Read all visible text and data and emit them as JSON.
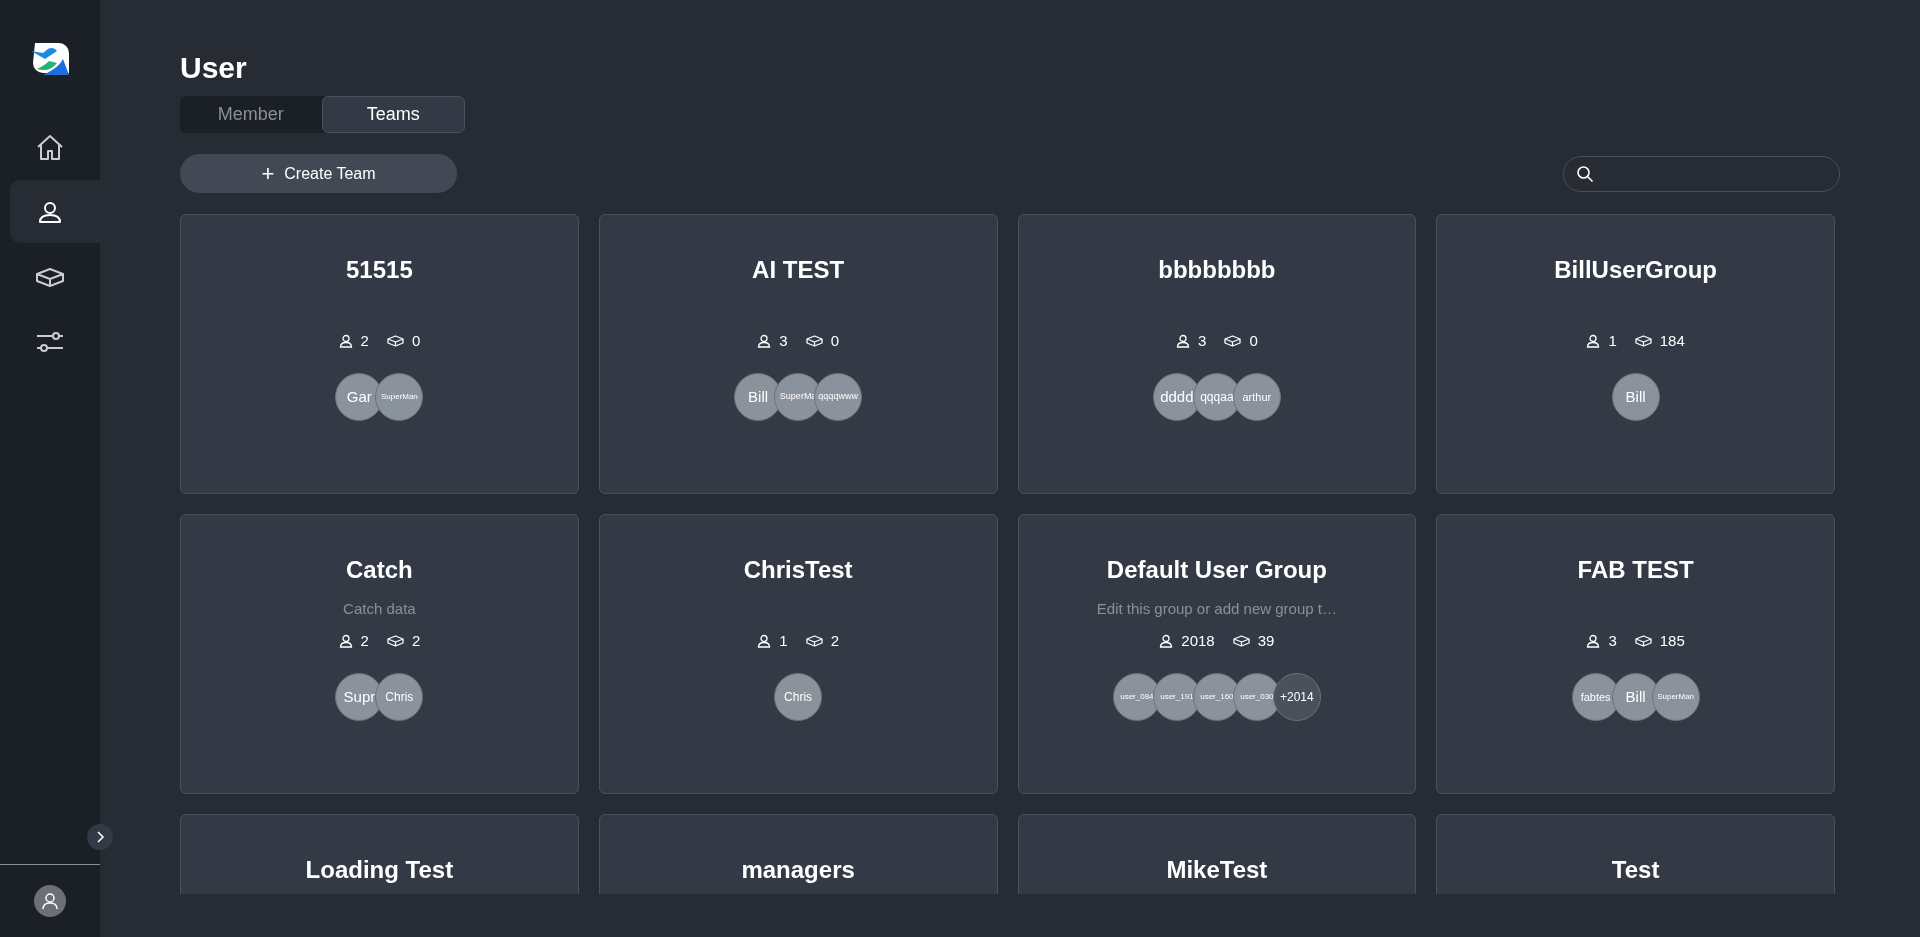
{
  "sidebar": {
    "nav": [
      {
        "kind": "home",
        "selected": false
      },
      {
        "kind": "user",
        "selected": true
      },
      {
        "kind": "box",
        "selected": false
      },
      {
        "kind": "sliders",
        "selected": false
      }
    ]
  },
  "page_title": "User",
  "tabs": [
    {
      "label": "Member",
      "selected": false
    },
    {
      "label": "Teams",
      "selected": true
    }
  ],
  "create_button": {
    "icon": "+",
    "label": "Create Team"
  },
  "teams": [
    {
      "name": "51515",
      "members": "2",
      "devices": "0",
      "avatars": [
        {
          "label": "Gar",
          "kind": "user"
        },
        {
          "label": "SuperMan",
          "kind": "user"
        }
      ]
    },
    {
      "name": "AI TEST",
      "members": "3",
      "devices": "0",
      "avatars": [
        {
          "label": "Bill",
          "kind": "user"
        },
        {
          "label": "SuperMa",
          "kind": "user"
        },
        {
          "label": "qqqqwww",
          "kind": "user"
        }
      ]
    },
    {
      "name": "bbbbbbbb",
      "members": "3",
      "devices": "0",
      "avatars": [
        {
          "label": "dddd",
          "kind": "user"
        },
        {
          "label": "qqqaa",
          "kind": "user"
        },
        {
          "label": "arthur",
          "kind": "user"
        }
      ]
    },
    {
      "name": "BillUserGroup",
      "members": "1",
      "devices": "184",
      "avatars": [
        {
          "label": "Bill",
          "kind": "user"
        }
      ]
    },
    {
      "name": "Catch",
      "description": "Catch data",
      "members": "2",
      "devices": "2",
      "avatars": [
        {
          "label": "Supr",
          "kind": "user"
        },
        {
          "label": "Chris",
          "kind": "user"
        }
      ]
    },
    {
      "name": "ChrisTest",
      "members": "1",
      "devices": "2",
      "avatars": [
        {
          "label": "Chris",
          "kind": "user"
        }
      ]
    },
    {
      "name": "Default User Group",
      "description": "Edit this group or add new group t…",
      "members": "2018",
      "devices": "39",
      "avatars": [
        {
          "label": "user_084",
          "kind": "user"
        },
        {
          "label": "user_191",
          "kind": "user"
        },
        {
          "label": "user_160",
          "kind": "user"
        },
        {
          "label": "user_030",
          "kind": "user"
        },
        {
          "label": "+2014",
          "kind": "more"
        }
      ]
    },
    {
      "name": "FAB TEST",
      "members": "3",
      "devices": "185",
      "avatars": [
        {
          "label": "fabtes",
          "kind": "user"
        },
        {
          "label": "Bill",
          "kind": "user"
        },
        {
          "label": "SuperMan",
          "kind": "user"
        }
      ]
    },
    {
      "name": "Loading Test"
    },
    {
      "name": "managers"
    },
    {
      "name": "MikeTest"
    },
    {
      "name": "Test"
    }
  ]
}
